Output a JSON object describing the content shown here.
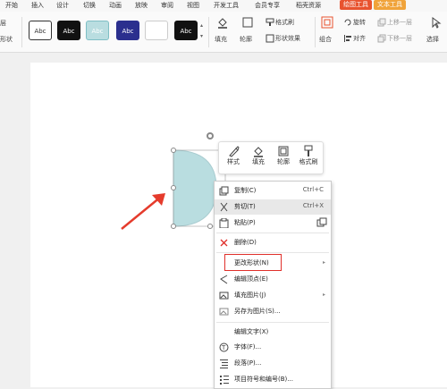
{
  "menubar": {
    "tabs": [
      "开始",
      "插入",
      "设计",
      "切换",
      "动画",
      "放映",
      "审阅",
      "视图",
      "开发工具",
      "会员专享",
      "稻壳资源"
    ],
    "drawing_tools": "绘图工具",
    "text_tools": "文本工具"
  },
  "ribbon": {
    "left_partial_1": "层",
    "left_partial_2": "形状",
    "styles": [
      {
        "label": "Abc",
        "bg": "#ffffff",
        "fg": "#333333",
        "border": "#333333"
      },
      {
        "label": "Abc",
        "bg": "#111111",
        "fg": "#ffffff",
        "border": "#111111"
      },
      {
        "label": "Abc",
        "bg": "#b9dde0",
        "fg": "#ffffff",
        "border": "#7fbfc5"
      },
      {
        "label": "Abc",
        "bg": "#2b2f8e",
        "fg": "#ffffff",
        "border": "#2b2f8e"
      },
      {
        "label": "",
        "bg": "#ffffff",
        "fg": "#333333",
        "border": "#cccccc"
      },
      {
        "label": "Abc",
        "bg": "#111111",
        "fg": "#ffffff",
        "border": "#111111"
      }
    ],
    "fill": "填充",
    "outline": "轮廓",
    "format_painter": "格式刷",
    "shape_effects": "形状效果",
    "combine": "组合",
    "rotate": "旋转",
    "align": "对齐",
    "bring_forward": "上移一层",
    "send_backward": "下移一层",
    "select": "选择"
  },
  "float_toolbar": {
    "style": "样式",
    "fill": "填充",
    "outline": "轮廓",
    "painter": "格式刷"
  },
  "context_menu": {
    "copy": "复制(C)",
    "copy_sc": "Ctrl+C",
    "cut": "剪切(T)",
    "cut_sc": "Ctrl+X",
    "paste": "粘贴(P)",
    "delete": "删除(D)",
    "change_shape": "更改形状(N)",
    "edit_points": "编辑顶点(E)",
    "fill_picture": "填充图片(J)",
    "save_as_picture": "另存为图片(S)...",
    "edit_text": "编辑文字(X)",
    "font": "字体(F)...",
    "paragraph": "段落(P)...",
    "bullets": "项目符号和编号(B)..."
  },
  "colors": {
    "accent_red": "#e0302b",
    "tab_green": "#e8532f",
    "tab_orange": "#f0a33a",
    "shape_fill": "#b9dde0",
    "arrow": "#e53b2c"
  }
}
